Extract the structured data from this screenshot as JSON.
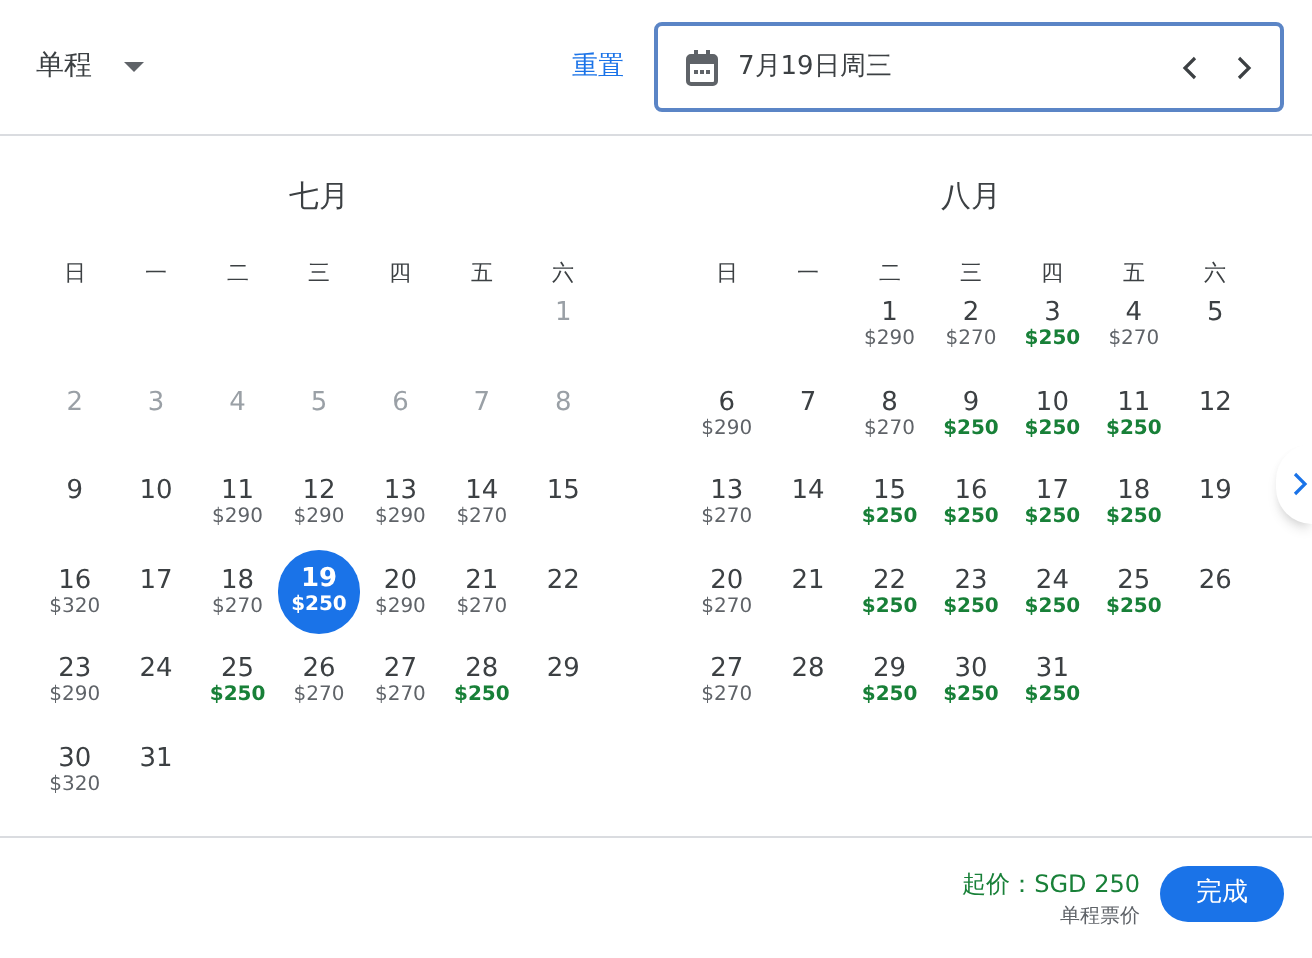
{
  "trip_type": {
    "label": "单程"
  },
  "reset_link": "重置",
  "date_field": {
    "value": "7月19日周三"
  },
  "months": [
    {
      "title": "七月",
      "weekdays": [
        "日",
        "一",
        "二",
        "三",
        "四",
        "五",
        "六"
      ],
      "weeks": [
        {
          "kind": "first",
          "days": [
            {
              "day": "1",
              "disabled": true,
              "selected": false
            }
          ]
        },
        {
          "kind": "full",
          "days": [
            {
              "day": "2",
              "disabled": true,
              "selected": false
            },
            {
              "day": "3",
              "disabled": true,
              "selected": false
            },
            {
              "day": "4",
              "disabled": true,
              "selected": false
            },
            {
              "day": "5",
              "disabled": true,
              "selected": false
            },
            {
              "day": "6",
              "disabled": true,
              "selected": false
            },
            {
              "day": "7",
              "disabled": true,
              "selected": false
            },
            {
              "day": "8",
              "disabled": true,
              "selected": false
            }
          ]
        },
        {
          "kind": "full",
          "days": [
            {
              "day": "9",
              "disabled": false,
              "selected": false
            },
            {
              "day": "10",
              "disabled": false,
              "selected": false
            },
            {
              "day": "11",
              "price": "$290",
              "low": false,
              "disabled": false,
              "selected": false
            },
            {
              "day": "12",
              "price": "$290",
              "low": false,
              "disabled": false,
              "selected": false
            },
            {
              "day": "13",
              "price": "$290",
              "low": false,
              "disabled": false,
              "selected": false
            },
            {
              "day": "14",
              "price": "$270",
              "low": false,
              "disabled": false,
              "selected": false
            },
            {
              "day": "15",
              "disabled": false,
              "selected": false
            }
          ]
        },
        {
          "kind": "full",
          "days": [
            {
              "day": "16",
              "price": "$320",
              "low": false,
              "disabled": false,
              "selected": false
            },
            {
              "day": "17",
              "disabled": false,
              "selected": false
            },
            {
              "day": "18",
              "price": "$270",
              "low": false,
              "disabled": false,
              "selected": false
            },
            {
              "day": "19",
              "price": "$250",
              "low": true,
              "disabled": false,
              "selected": true
            },
            {
              "day": "20",
              "price": "$290",
              "low": false,
              "disabled": false,
              "selected": false
            },
            {
              "day": "21",
              "price": "$270",
              "low": false,
              "disabled": false,
              "selected": false
            },
            {
              "day": "22",
              "disabled": false,
              "selected": false
            }
          ]
        },
        {
          "kind": "full",
          "days": [
            {
              "day": "23",
              "price": "$290",
              "low": false,
              "disabled": false,
              "selected": false
            },
            {
              "day": "24",
              "disabled": false,
              "selected": false
            },
            {
              "day": "25",
              "price": "$250",
              "low": true,
              "disabled": false,
              "selected": false
            },
            {
              "day": "26",
              "price": "$270",
              "low": false,
              "disabled": false,
              "selected": false
            },
            {
              "day": "27",
              "price": "$270",
              "low": false,
              "disabled": false,
              "selected": false
            },
            {
              "day": "28",
              "price": "$250",
              "low": true,
              "disabled": false,
              "selected": false
            },
            {
              "day": "29",
              "disabled": false,
              "selected": false
            }
          ]
        },
        {
          "kind": "last",
          "days": [
            {
              "day": "30",
              "price": "$320",
              "low": false,
              "disabled": false,
              "selected": false
            },
            {
              "day": "31",
              "disabled": false,
              "selected": false
            }
          ]
        }
      ]
    },
    {
      "title": "八月",
      "weekdays": [
        "日",
        "一",
        "二",
        "三",
        "四",
        "五",
        "六"
      ],
      "weeks": [
        {
          "kind": "first",
          "days": [
            {
              "day": "1",
              "price": "$290",
              "low": false,
              "disabled": false,
              "selected": false
            },
            {
              "day": "2",
              "price": "$270",
              "low": false,
              "disabled": false,
              "selected": false
            },
            {
              "day": "3",
              "price": "$250",
              "low": true,
              "disabled": false,
              "selected": false
            },
            {
              "day": "4",
              "price": "$270",
              "low": false,
              "disabled": false,
              "selected": false
            },
            {
              "day": "5",
              "disabled": false,
              "selected": false
            }
          ]
        },
        {
          "kind": "full",
          "days": [
            {
              "day": "6",
              "price": "$290",
              "low": false,
              "disabled": false,
              "selected": false
            },
            {
              "day": "7",
              "disabled": false,
              "selected": false
            },
            {
              "day": "8",
              "price": "$270",
              "low": false,
              "disabled": false,
              "selected": false
            },
            {
              "day": "9",
              "price": "$250",
              "low": true,
              "disabled": false,
              "selected": false
            },
            {
              "day": "10",
              "price": "$250",
              "low": true,
              "disabled": false,
              "selected": false
            },
            {
              "day": "11",
              "price": "$250",
              "low": true,
              "disabled": false,
              "selected": false
            },
            {
              "day": "12",
              "disabled": false,
              "selected": false
            }
          ]
        },
        {
          "kind": "full",
          "days": [
            {
              "day": "13",
              "price": "$270",
              "low": false,
              "disabled": false,
              "selected": false
            },
            {
              "day": "14",
              "disabled": false,
              "selected": false
            },
            {
              "day": "15",
              "price": "$250",
              "low": true,
              "disabled": false,
              "selected": false
            },
            {
              "day": "16",
              "price": "$250",
              "low": true,
              "disabled": false,
              "selected": false
            },
            {
              "day": "17",
              "price": "$250",
              "low": true,
              "disabled": false,
              "selected": false
            },
            {
              "day": "18",
              "price": "$250",
              "low": true,
              "disabled": false,
              "selected": false
            },
            {
              "day": "19",
              "disabled": false,
              "selected": false
            }
          ]
        },
        {
          "kind": "full",
          "days": [
            {
              "day": "20",
              "price": "$270",
              "low": false,
              "disabled": false,
              "selected": false
            },
            {
              "day": "21",
              "disabled": false,
              "selected": false
            },
            {
              "day": "22",
              "price": "$250",
              "low": true,
              "disabled": false,
              "selected": false
            },
            {
              "day": "23",
              "price": "$250",
              "low": true,
              "disabled": false,
              "selected": false
            },
            {
              "day": "24",
              "price": "$250",
              "low": true,
              "disabled": false,
              "selected": false
            },
            {
              "day": "25",
              "price": "$250",
              "low": true,
              "disabled": false,
              "selected": false
            },
            {
              "day": "26",
              "disabled": false,
              "selected": false
            }
          ]
        },
        {
          "kind": "last",
          "days": [
            {
              "day": "27",
              "price": "$270",
              "low": false,
              "disabled": false,
              "selected": false
            },
            {
              "day": "28",
              "disabled": false,
              "selected": false
            },
            {
              "day": "29",
              "price": "$250",
              "low": true,
              "disabled": false,
              "selected": false
            },
            {
              "day": "30",
              "price": "$250",
              "low": true,
              "disabled": false,
              "selected": false
            },
            {
              "day": "31",
              "price": "$250",
              "low": true,
              "disabled": false,
              "selected": false
            }
          ]
        }
      ]
    }
  ],
  "footer": {
    "price_from": "起价：SGD 250",
    "price_note": "单程票价",
    "done_button": "完成"
  }
}
